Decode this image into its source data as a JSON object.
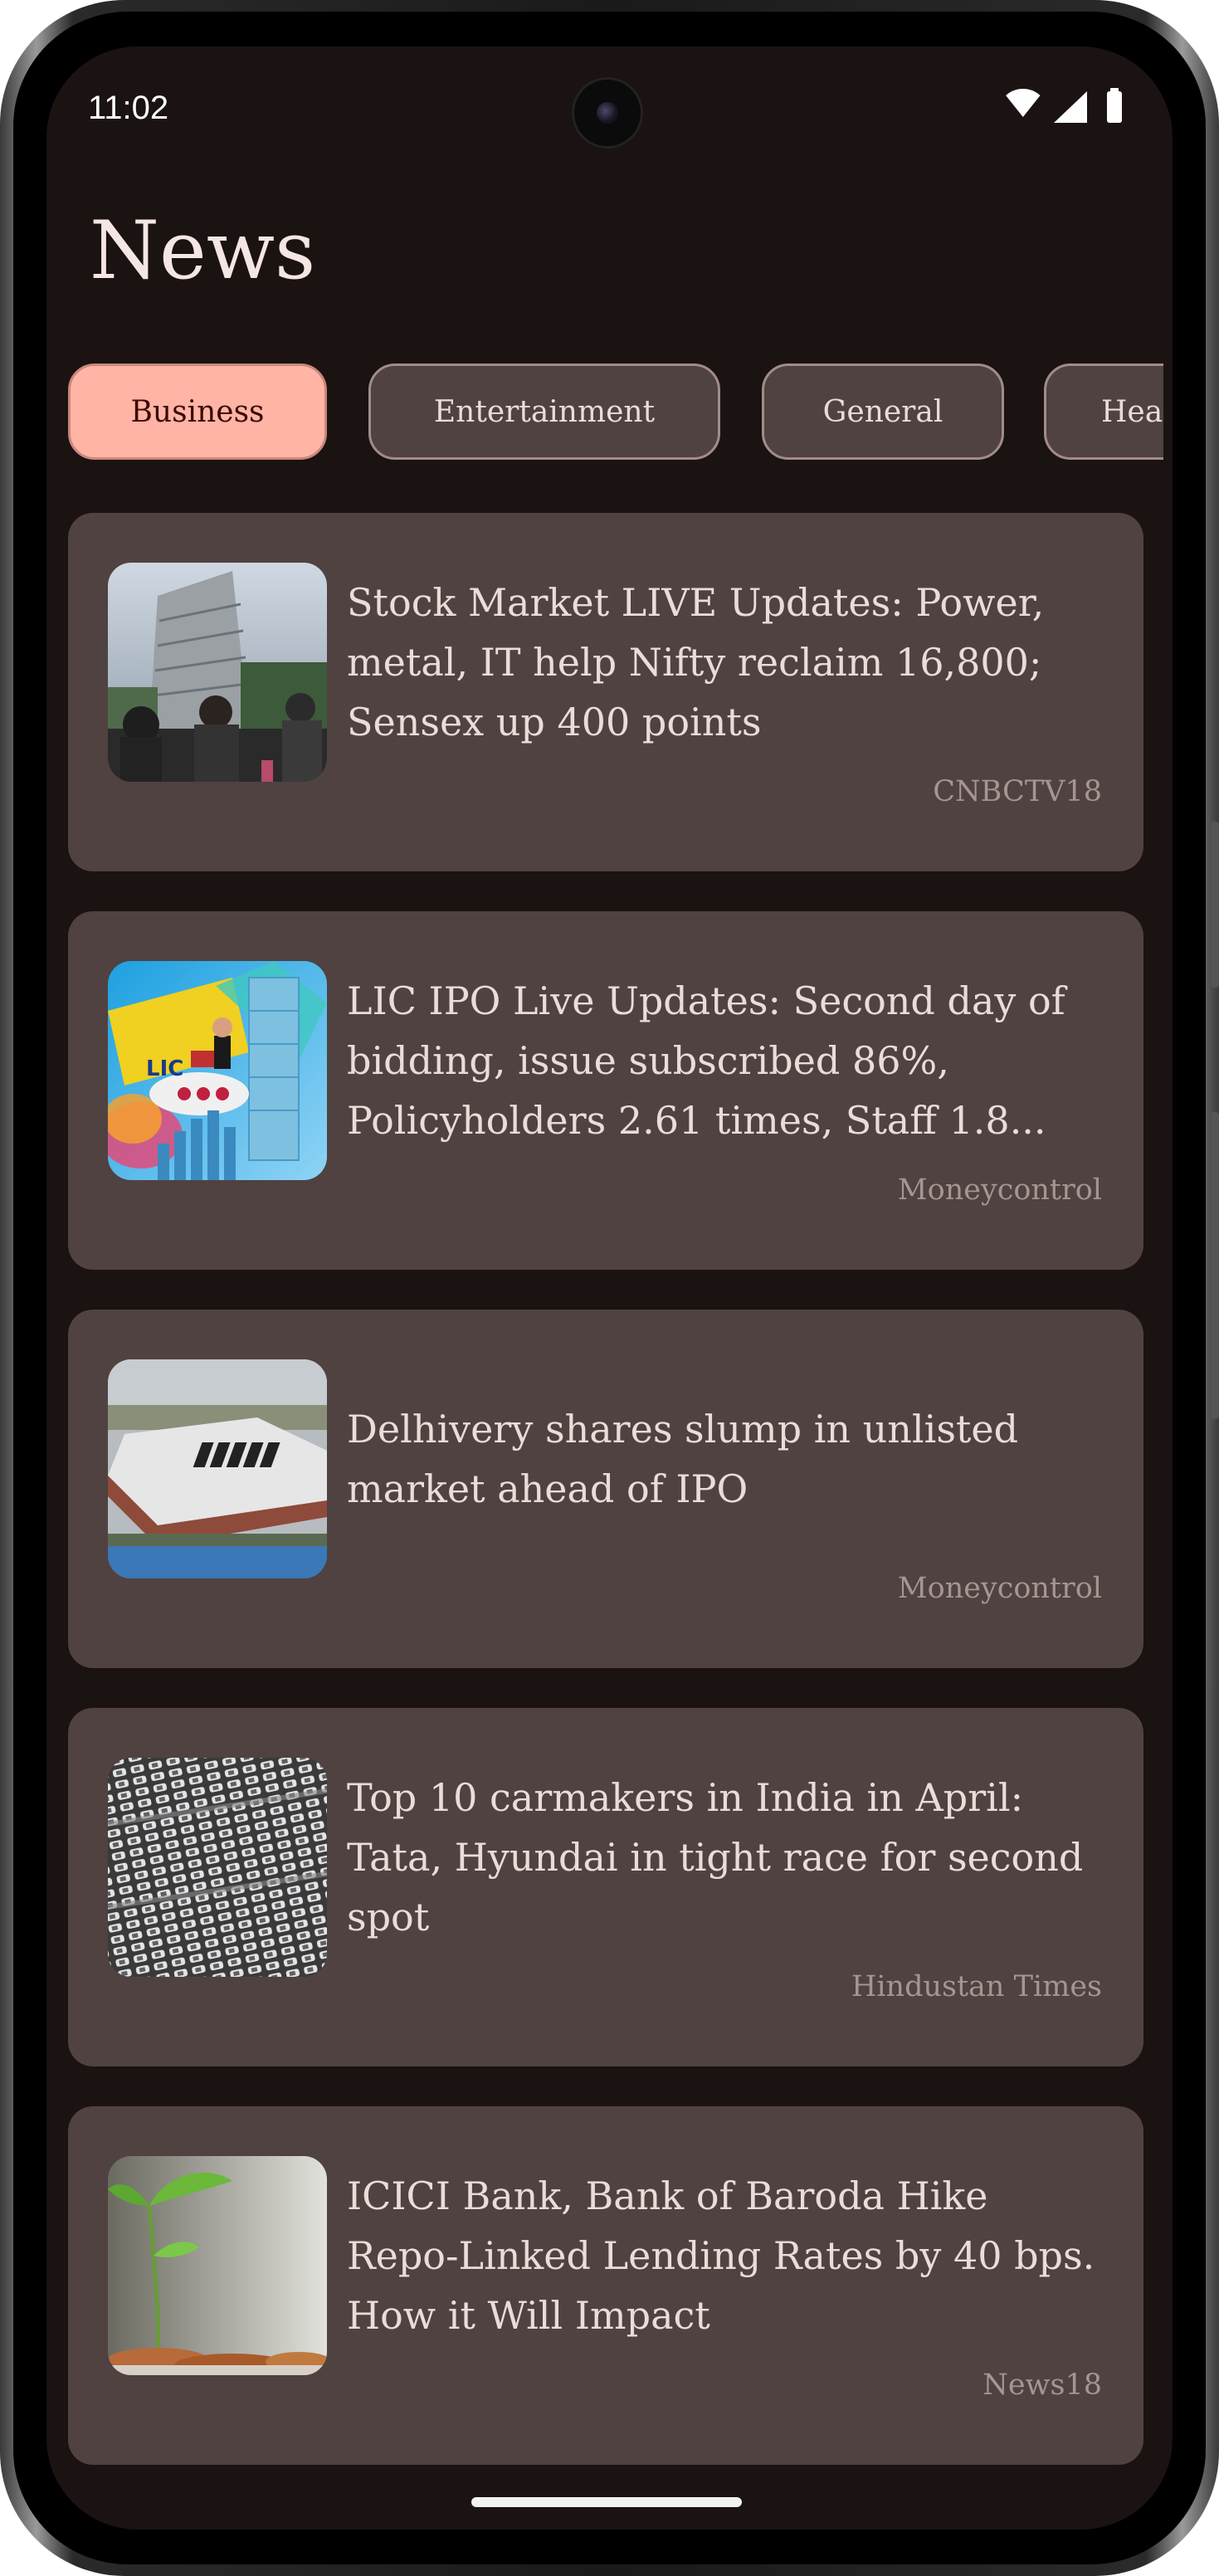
{
  "status_bar": {
    "time": "11:02",
    "icons": [
      "wifi-icon",
      "cellular-signal-icon",
      "battery-icon"
    ]
  },
  "header": {
    "title": "News"
  },
  "categories": [
    {
      "label": "Business",
      "selected": true
    },
    {
      "label": "Entertainment",
      "selected": false
    },
    {
      "label": "General",
      "selected": false
    },
    {
      "label": "Hea",
      "selected": false
    }
  ],
  "articles": [
    {
      "headline": "Stock Market LIVE Updates: Power, metal, IT help Nifty reclaim 16,800; Sensex up 400 points",
      "source": "CNBCTV18",
      "thumbnail": "stock-exchange-building-photo"
    },
    {
      "headline": "LIC IPO Live Updates: Second day of bidding, issue subscribed 86%, Policyholders 2.61 times, Staff 1.8...",
      "source": "Moneycontrol",
      "thumbnail": "lic-ipo-rocket-illustration"
    },
    {
      "headline": "Delhivery shares slump in unlisted market ahead of IPO",
      "source": "Moneycontrol",
      "thumbnail": "delhivery-warehouse-aerial-photo"
    },
    {
      "headline": "Top 10 carmakers in India in April: Tata, Hyundai in tight race for second spot",
      "source": "Hindustan Times",
      "thumbnail": "parked-cars-aerial-photo"
    },
    {
      "headline": "ICICI Bank, Bank of Baroda Hike Repo-Linked Lending Rates by 40 bps. How it Will Impact",
      "source": "News18",
      "thumbnail": "plant-growing-from-coins-photo"
    }
  ],
  "colors": {
    "background": "#1b1212",
    "card": "#4f4240",
    "chip_selected": "#ffb4a6",
    "text_primary": "#e9dcd9",
    "text_secondary": "#a69592"
  }
}
